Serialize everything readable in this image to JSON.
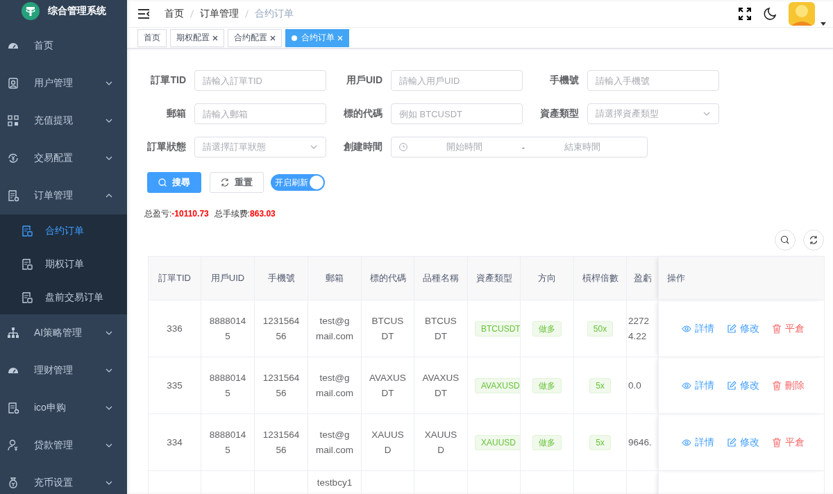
{
  "app": {
    "title": "综合管理系统"
  },
  "sidebar": {
    "items": [
      {
        "label": "首页",
        "kind": "link",
        "selected": false
      },
      {
        "label": "用户管理",
        "kind": "submenu",
        "expanded": false
      },
      {
        "label": "充值提现",
        "kind": "submenu",
        "expanded": false
      },
      {
        "label": "交易配置",
        "kind": "submenu",
        "expanded": false
      },
      {
        "label": "订单管理",
        "kind": "submenu",
        "expanded": true,
        "children": [
          {
            "label": "合约订单",
            "selected": true
          },
          {
            "label": "期权订单",
            "selected": false
          },
          {
            "label": "盘前交易订单",
            "selected": false
          }
        ]
      },
      {
        "label": "AI策略管理",
        "kind": "submenu",
        "expanded": false
      },
      {
        "label": "理财管理",
        "kind": "submenu",
        "expanded": false
      },
      {
        "label": "ico申购",
        "kind": "submenu",
        "expanded": false
      },
      {
        "label": "贷款管理",
        "kind": "submenu",
        "expanded": false
      },
      {
        "label": "充币设置",
        "kind": "submenu",
        "expanded": false
      }
    ]
  },
  "breadcrumb": [
    "首页",
    "订单管理",
    "合约订单"
  ],
  "tabs": [
    {
      "label": "首页",
      "selected": false,
      "closable": false
    },
    {
      "label": "期权配置",
      "selected": false,
      "closable": true
    },
    {
      "label": "合约配置",
      "selected": false,
      "closable": true
    },
    {
      "label": "合约订单",
      "selected": true,
      "closable": true
    }
  ],
  "filters": [
    {
      "label": "訂單TID",
      "kind": "input",
      "placeholder": "請輸入訂單TID"
    },
    {
      "label": "用戶UID",
      "kind": "input",
      "placeholder": "請輸入用戶UID"
    },
    {
      "label": "手機號",
      "kind": "input",
      "placeholder": "請輸入手機號"
    },
    {
      "label": "郵箱",
      "kind": "input",
      "placeholder": "請輸入郵箱"
    },
    {
      "label": "標的代碼",
      "kind": "input",
      "placeholder": "例如 BTCUSDT"
    },
    {
      "label": "資產類型",
      "kind": "select",
      "placeholder": "請選擇資產類型"
    },
    {
      "label": "訂單狀態",
      "kind": "select",
      "placeholder": "請選擇訂單狀態"
    },
    {
      "label": "創建時間",
      "kind": "daterange",
      "start_placeholder": "開始時間",
      "separator": "-",
      "end_placeholder": "結束時間"
    }
  ],
  "buttons": [
    {
      "label": "搜尋",
      "kind": "primary"
    },
    {
      "label": "重置",
      "kind": "reset"
    }
  ],
  "auto_refresh": {
    "label": "开启刷新",
    "on": true
  },
  "summary": [
    {
      "label": "总盈亏:",
      "value": "-10110.73"
    },
    {
      "label": "总手续费:",
      "value": "863.03"
    }
  ],
  "table": {
    "columns": [
      "訂單TID",
      "用戶UID",
      "手機號",
      "郵箱",
      "標的代碼",
      "品種名稱",
      "資產類型",
      "方向",
      "槓桿倍數",
      "盈虧",
      "操作"
    ],
    "rows": [
      {
        "tid": "336",
        "uid": "88880145",
        "phone": "123156456",
        "email": "test@gmail.com",
        "symbol": "BTCUSDT",
        "product": "BTCUSDT",
        "asset_type": "BTCUSDT",
        "direction": "做多",
        "leverage": "50x",
        "profit": "22724.22",
        "actions": [
          {
            "label": "詳情",
            "kind": "view"
          },
          {
            "label": "修改",
            "kind": "edit"
          },
          {
            "label": "平倉",
            "kind": "danger"
          }
        ]
      },
      {
        "tid": "335",
        "uid": "88880145",
        "phone": "123156456",
        "email": "test@gmail.com",
        "symbol": "AVAXUSDT",
        "product": "AVAXUSDT",
        "asset_type": "AVAXUSD",
        "direction": "做多",
        "leverage": "5x",
        "profit": "0.0",
        "actions": [
          {
            "label": "詳情",
            "kind": "view"
          },
          {
            "label": "修改",
            "kind": "edit"
          },
          {
            "label": "刪除",
            "kind": "danger"
          }
        ]
      },
      {
        "tid": "334",
        "uid": "88880145",
        "phone": "123156456",
        "email": "test@gmail.com",
        "symbol": "XAUUSD",
        "product": "XAUUSD",
        "asset_type": "XAUUSD",
        "direction": "做多",
        "leverage": "5x",
        "profit": "9646.",
        "actions": [
          {
            "label": "詳情",
            "kind": "view"
          },
          {
            "label": "修改",
            "kind": "edit"
          },
          {
            "label": "平倉",
            "kind": "danger"
          }
        ]
      },
      {
        "email": "testbcy1"
      }
    ]
  }
}
